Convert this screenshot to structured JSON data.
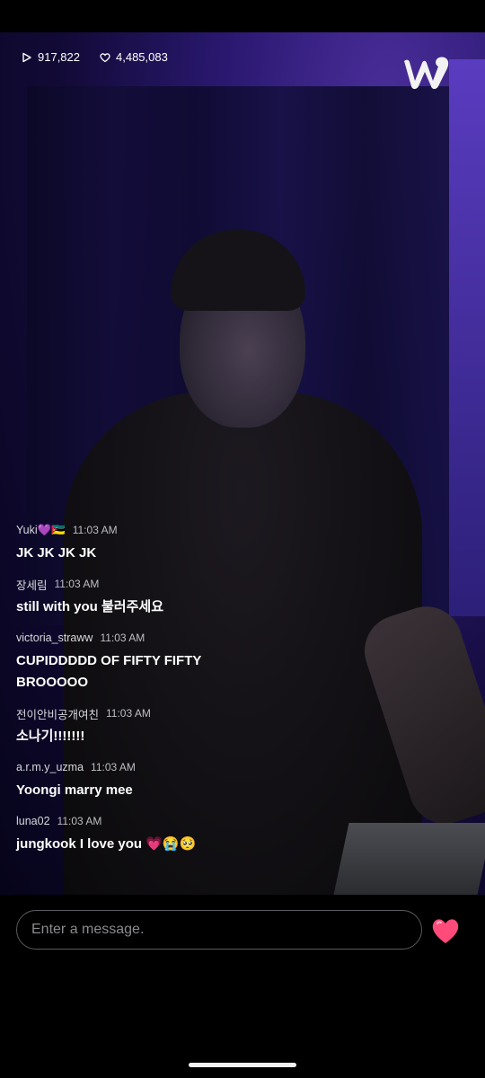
{
  "stats": {
    "views": "917,822",
    "likes": "4,485,083"
  },
  "icons": {
    "views": "play-icon",
    "likes": "heart-outline-icon",
    "logo": "weverse-logo",
    "send": "heart-filled-icon"
  },
  "colors": {
    "accent_heart": "#ff4b7a",
    "video_tint": "#3a26a0"
  },
  "chat": {
    "messages": [
      {
        "user": "Yuki💜🇲🇿",
        "time": "11:03 AM",
        "text": "JK JK JK JK"
      },
      {
        "user": "장세림",
        "time": "11:03 AM",
        "text": "still with you 불러주세요"
      },
      {
        "user": "victoria_straww",
        "time": "11:03 AM",
        "text": "CUPIDDDDD OF FIFTY FIFTY",
        "text2": "BROOOOO"
      },
      {
        "user": "전이안비공개여친",
        "time": "11:03 AM",
        "text": "소나기!!!!!!!"
      },
      {
        "user": "a.r.m.y_uzma",
        "time": "11:03 AM",
        "text": "Yoongi marry mee"
      },
      {
        "user": "luna02",
        "time": "11:03 AM",
        "text": "jungkook I love you",
        "emojis": "💗😭🥺"
      }
    ]
  },
  "input": {
    "placeholder": "Enter a message."
  }
}
